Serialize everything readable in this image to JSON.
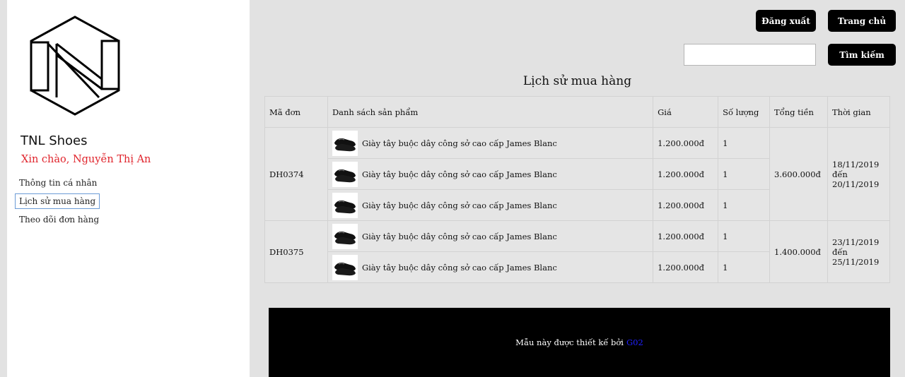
{
  "sidebar": {
    "brand": "TNL Shoes",
    "greeting": "Xin chào, Nguyễn Thị An",
    "items": [
      {
        "label": "Thông tin cá nhân"
      },
      {
        "label": "Lịch sử mua hàng",
        "active": true
      },
      {
        "label": "Theo dõi đơn hàng"
      }
    ]
  },
  "header": {
    "logout_label": "Đăng xuất",
    "home_label": "Trang chủ",
    "search_label": "Tìm kiếm",
    "search_value": ""
  },
  "main": {
    "title": "Lịch sử mua hàng",
    "columns": [
      "Mã đơn",
      "Danh sách sản phẩm",
      "Giá",
      "Số lượng",
      "Tổng tiền",
      "Thời gian"
    ],
    "orders": [
      {
        "id": "DH0374",
        "total": "3.600.000đ",
        "time_from": "18/11/2019",
        "time_sep": "đến",
        "time_to": "20/11/2019",
        "products": [
          {
            "name": "Giày tây buộc dây công sở cao cấp James Blanc",
            "price": "1.200.000đ",
            "qty": "1"
          },
          {
            "name": "Giày tây buộc dây công sở cao cấp James Blanc",
            "price": "1.200.000đ",
            "qty": "1"
          },
          {
            "name": "Giày tây buộc dây công sở cao cấp James Blanc",
            "price": "1.200.000đ",
            "qty": "1"
          }
        ]
      },
      {
        "id": "DH0375",
        "total": "1.400.000đ",
        "time_from": "23/11/2019",
        "time_sep": "đến",
        "time_to": "25/11/2019",
        "products": [
          {
            "name": "Giày tây buộc dây công sở cao cấp James Blanc",
            "price": "1.200.000đ",
            "qty": "1"
          },
          {
            "name": "Giày tây buộc dây công sở cao cấp James Blanc",
            "price": "1.200.000đ",
            "qty": "1"
          }
        ]
      }
    ]
  },
  "footer": {
    "text": "Mẫu này được thiết kế bởi",
    "link": "G02"
  },
  "colors": {
    "greeting": "#e0242c",
    "footer_link": "#2020ff",
    "button": "#000000"
  }
}
